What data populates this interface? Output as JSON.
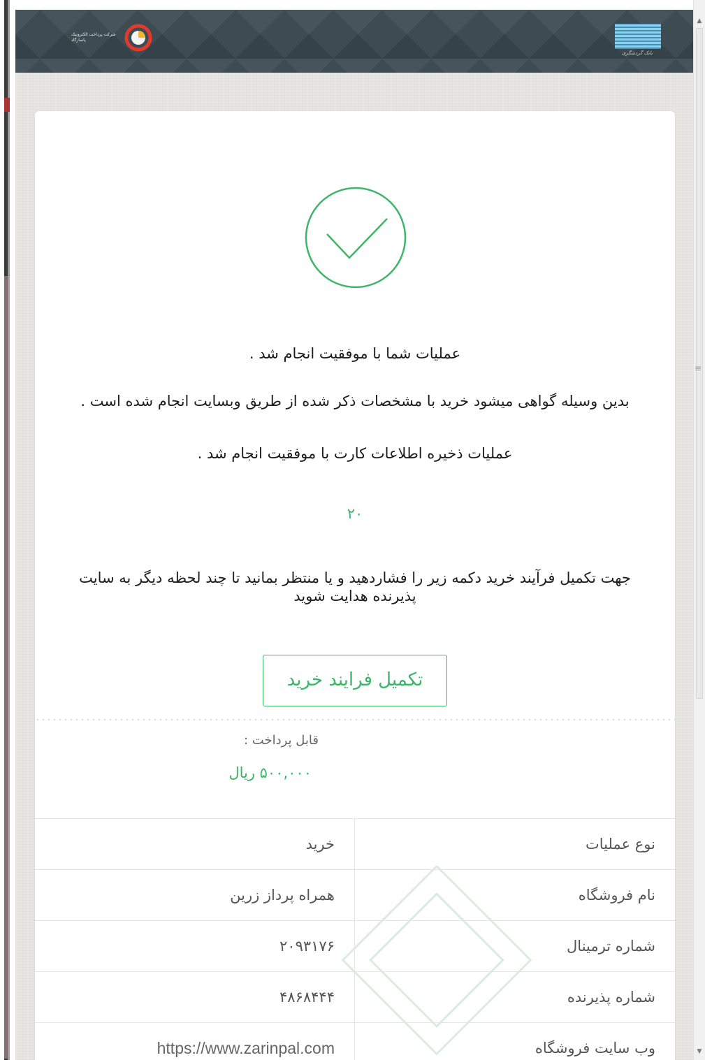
{
  "header": {
    "left_logo_text": "شرکت پرداخت الکترونیک پاسارگاد",
    "right_logo_text": "بانک گردشگری"
  },
  "status": {
    "message_success": "عملیات شما با موفقیت انجام شد .",
    "message_certify": "بدین وسیله گواهی میشود خرید با مشخصات ذکر شده از طریق وبسایت انجام شده است .",
    "message_card_saved": "عملیات ذخیره اطلاعات کارت با موفقیت انجام شد .",
    "countdown": "۲۰",
    "message_redirect": "جهت تکمیل فرآیند خرید دکمه زیر را فشاردهید و یا منتظر بمانید تا چند لحظه دیگر به سایت پذیرنده هدایت شوید"
  },
  "actions": {
    "complete_purchase_label": "تکمیل فرایند خرید"
  },
  "payment": {
    "payable_label": "قابل پرداخت :",
    "payable_amount": "۵۰۰,۰۰۰ ریال"
  },
  "details": {
    "rows": [
      {
        "label": "نوع عملیات",
        "value": "خرید"
      },
      {
        "label": "نام فروشگاه",
        "value": "همراه پرداز زرین"
      },
      {
        "label": "شماره ترمینال",
        "value": "۲۰۹۳۱۷۶"
      },
      {
        "label": "شماره پذیرنده",
        "value": "۴۸۶۸۴۴۴"
      },
      {
        "label": "وب سایت فروشگاه",
        "value": "https://www.zarinpal.com"
      }
    ]
  },
  "colors": {
    "accent_green": "#3fb56a",
    "header_bg": "#3d4b53",
    "page_bg": "#e7e6e2"
  },
  "icons": {
    "success": "check-circle-icon",
    "scroll_up": "triangle-up",
    "scroll_down": "triangle-down"
  }
}
